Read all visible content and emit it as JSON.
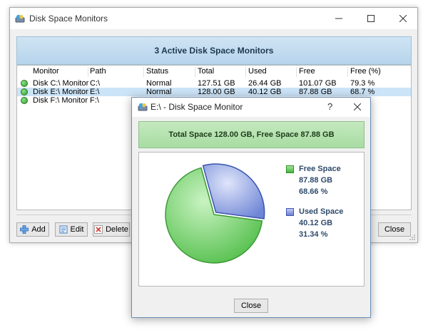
{
  "main_window": {
    "title": "Disk Space Monitors",
    "banner": "3 Active Disk Space Monitors",
    "columns": [
      "Monitor",
      "Path",
      "Status",
      "Total",
      "Used",
      "Free",
      "Free (%)"
    ],
    "rows": [
      {
        "monitor": "Disk C:\\ Monitor",
        "path": "C:\\",
        "status": "Normal",
        "total": "127.51 GB",
        "used": "26.44 GB",
        "free": "101.07 GB",
        "free_pct": "79.3 %",
        "selected": false
      },
      {
        "monitor": "Disk E:\\ Monitor",
        "path": "E:\\",
        "status": "Normal",
        "total": "128.00 GB",
        "used": "40.12 GB",
        "free": "87.88 GB",
        "free_pct": "68.7 %",
        "selected": true
      },
      {
        "monitor": "Disk F:\\ Monitor",
        "path": "F:\\",
        "status": "",
        "total": "",
        "used": "",
        "free": "",
        "free_pct": "",
        "selected": false
      }
    ],
    "buttons": {
      "add": "Add",
      "edit": "Edit",
      "delete": "Delete",
      "close": "Close"
    }
  },
  "dialog": {
    "title": "E:\\ - Disk Space Monitor",
    "help": "?",
    "banner": "Total Space 128.00 GB, Free Space 87.88 GB",
    "close_button": "Close",
    "legend": {
      "free": {
        "label": "Free Space",
        "size": "87.88 GB",
        "percent": "68.66 %"
      },
      "used": {
        "label": "Used Space",
        "size": "40.12 GB",
        "percent": "31.34 %"
      }
    }
  },
  "chart_data": {
    "type": "pie",
    "categories": [
      "Free Space",
      "Used Space"
    ],
    "values": [
      87.88,
      40.12
    ],
    "percent": [
      68.66,
      31.34
    ],
    "colors": [
      "#5cc854",
      "#7b8fd8"
    ]
  },
  "colors": {
    "accent_blue_banner": "#c4ddf0",
    "accent_green_banner": "#b6e2b0",
    "selection": "#cce4f7",
    "free": "#5cc854",
    "used": "#7b8fd8"
  }
}
